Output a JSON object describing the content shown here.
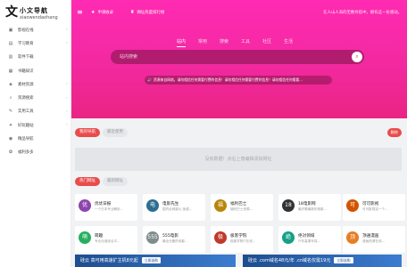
{
  "logo": {
    "mark": "文",
    "cn": "小文导航",
    "en": "xiaowendaohang"
  },
  "sidebar": {
    "items": [
      {
        "label": "影视在线",
        "icon": "film-icon",
        "glyph": "▣",
        "chev": "›"
      },
      {
        "label": "学习教育",
        "icon": "book-icon",
        "glyph": "▤",
        "chev": "›"
      },
      {
        "label": "软件下载",
        "icon": "download-icon",
        "glyph": "▥",
        "chev": ""
      },
      {
        "label": "书籍知识",
        "icon": "bookmark-icon",
        "glyph": "▦",
        "chev": ""
      },
      {
        "label": "素材资源",
        "icon": "palette-icon",
        "glyph": "◈",
        "chev": "›"
      },
      {
        "label": "资源搜索",
        "icon": "search-icon",
        "glyph": "⌕",
        "chev": "›"
      },
      {
        "label": "实用工具",
        "icon": "tool-icon",
        "glyph": "✎",
        "chev": "›"
      },
      {
        "label": "好玩趣站",
        "icon": "game-icon",
        "glyph": "✦",
        "chev": "›"
      },
      {
        "label": "精品导航",
        "icon": "compass-icon",
        "glyph": "◉",
        "chev": ""
      },
      {
        "label": "福利多多",
        "icon": "gift-icon",
        "glyph": "✿",
        "chev": ""
      }
    ]
  },
  "topbar": {
    "apply_label": "申请收录",
    "apply_glyph": "★",
    "rank_label": "网址热度排行榜",
    "rank_glyph": "♜",
    "notice": "在人山人海的无数导航中，拥有这一份感动。"
  },
  "search": {
    "tabs": [
      "站内",
      "常用",
      "搜索",
      "工具",
      "社区",
      "生活"
    ],
    "active_tab": 0,
    "placeholder": "站内搜索"
  },
  "announce": {
    "glyph": "🔊",
    "text": "资源来自网络，请勿相信任何需要付费的信息！请勿相信任何需要付费的信息！请勿相信任何需要..."
  },
  "mynav": {
    "tab_active": "我的导航",
    "tab_other": "最近使用",
    "badge": "删除",
    "empty_text": "没有数据！点右上角编辑添加网址"
  },
  "hot": {
    "tab_active": "热门网址",
    "tab_other": "最新网址"
  },
  "cards": [
    {
      "name": "优优日报",
      "desc": "一个日本专业解析...",
      "avatar": "优",
      "color": "#8e44ad"
    },
    {
      "name": "电影先生",
      "desc": "国内全网影片,免费...",
      "avatar": "电",
      "color": "#2c6e91"
    },
    {
      "name": "福利巴士",
      "desc": "福利巴士资源...",
      "avatar": "福",
      "color": "#b8860b"
    },
    {
      "name": "18电影网",
      "desc": "最好看最新的电影...",
      "avatar": "18",
      "color": "#333333"
    },
    {
      "name": "可可影视",
      "desc": "可可影视这一个...",
      "avatar": "可",
      "color": "#d35400"
    },
    {
      "name": "萌趣",
      "desc": "专业动漫综合平...",
      "avatar": "萌",
      "color": "#27ae60"
    },
    {
      "name": "555电影",
      "desc": "最全无删的电影...",
      "avatar": "555",
      "color": "#7f8c8d"
    },
    {
      "name": "极客学院",
      "desc": "极客学院IT在线...",
      "avatar": "极",
      "color": "#c0392b"
    },
    {
      "name": "绝对领域",
      "desc": "汽车高清写真...",
      "avatar": "绝",
      "color": "#16a085"
    },
    {
      "name": "顶通漫画",
      "desc": "漫画资源在线...",
      "avatar": "顶",
      "color": "#e67e22"
    }
  ],
  "banners": [
    {
      "text": "硅云  高可用高速扩主机8元起",
      "button": "立即选购"
    },
    {
      "text": "硅云  .com域名48元/年 .cn域名仅需19元",
      "button": "立即选购"
    }
  ]
}
